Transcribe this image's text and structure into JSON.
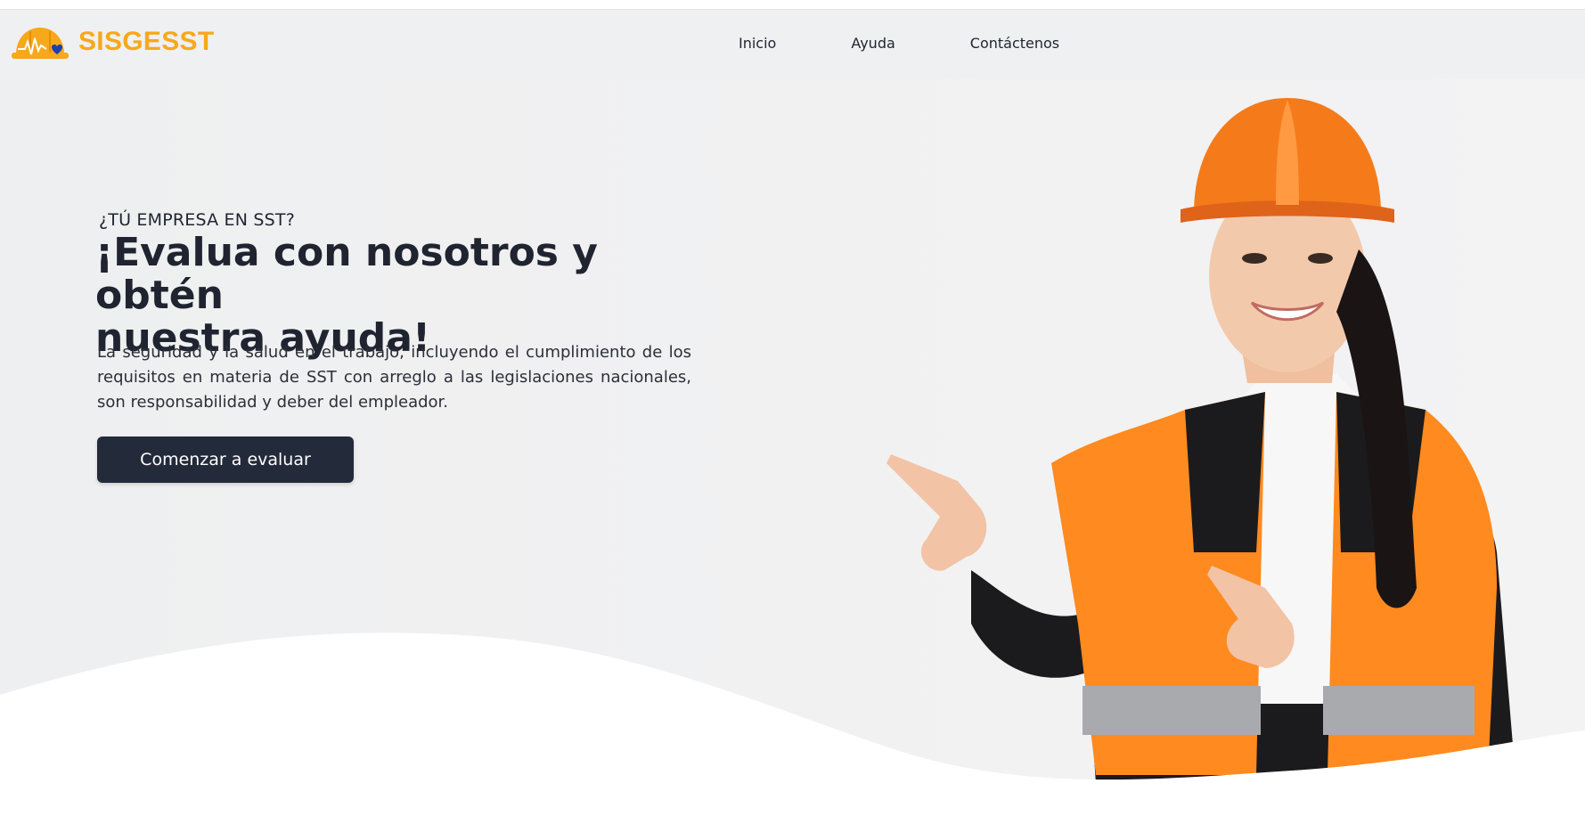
{
  "header": {
    "brand_name": "SISGESST",
    "logo_icon": "hardhat-logo-icon",
    "nav": {
      "inicio": "Inicio",
      "ayuda": "Ayuda",
      "contactenos": "Contáctenos"
    }
  },
  "hero": {
    "eyebrow": "¿TÚ EMPRESA EN SST?",
    "headline_line1": "¡Evalua con nosotros y obtén",
    "headline_line2": "nuestra ayuda!",
    "description": "La seguridad y la salud en el trabajo, incluyendo el cumplimiento de los requisitos en materia de SST con arreglo a las legislaciones nacionales, son responsabilidad y deber del empleador.",
    "cta_label": "Comenzar a evaluar",
    "image": "worker-with-hardhat-pointing-image"
  },
  "colors": {
    "brand": "#f7a81b",
    "text_dark": "#1f2430",
    "button_bg": "#232a3a",
    "hero_bg": "#f0f0f1",
    "helmet_orange": "#f57b1a",
    "vest_orange": "#ff8a1f"
  }
}
